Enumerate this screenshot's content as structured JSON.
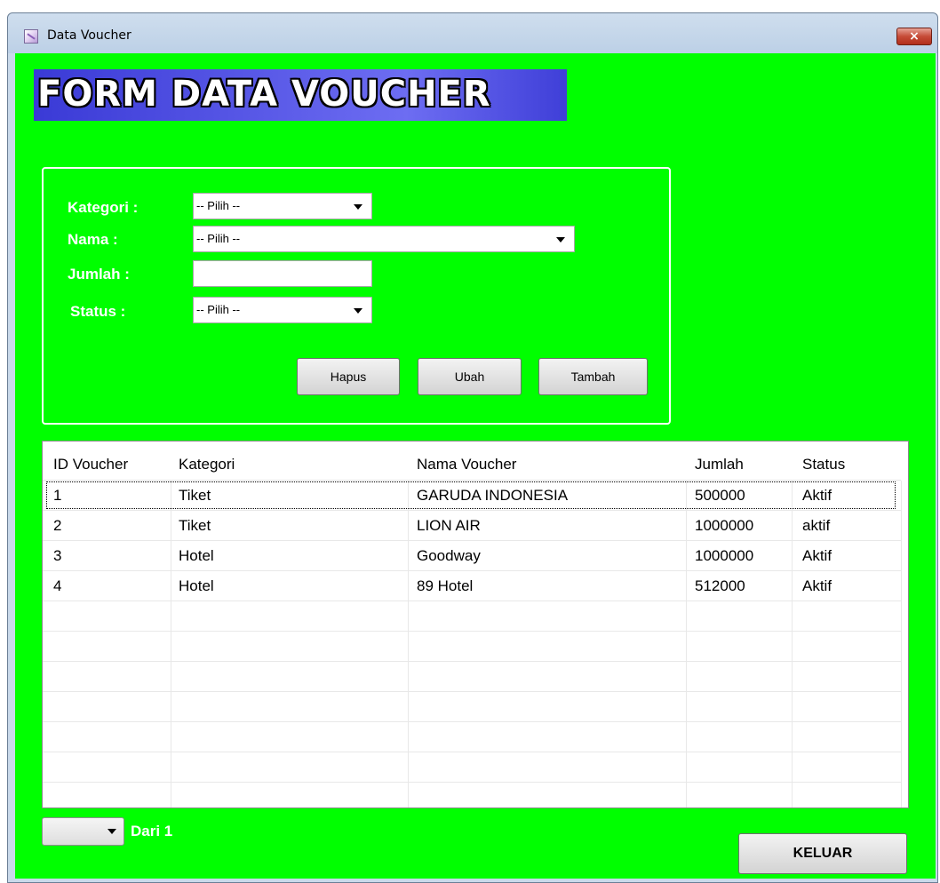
{
  "window": {
    "title": "Data Voucher",
    "close_label": "×"
  },
  "banner": {
    "text": "FORM DATA VOUCHER"
  },
  "form": {
    "kategori": {
      "label": "Kategori :",
      "value": "-- Pilih --"
    },
    "nama": {
      "label": "Nama :",
      "value": "-- Pilih --"
    },
    "jumlah": {
      "label": "Jumlah :",
      "value": ""
    },
    "status": {
      "label": "Status :",
      "value": "-- Pilih --"
    },
    "buttons": {
      "hapus": "Hapus",
      "ubah": "Ubah",
      "tambah": "Tambah"
    }
  },
  "table": {
    "columns": [
      "ID Voucher",
      "Kategori",
      "Nama Voucher",
      "Jumlah",
      "Status"
    ],
    "rows": [
      [
        "1",
        "Tiket",
        "GARUDA INDONESIA",
        "500000",
        "Aktif"
      ],
      [
        "2",
        "Tiket",
        "LION AIR",
        "1000000",
        "aktif"
      ],
      [
        "3",
        "Hotel",
        "Goodway",
        "1000000",
        "Aktif"
      ],
      [
        "4",
        "Hotel",
        "89 Hotel",
        "512000",
        "Aktif"
      ]
    ]
  },
  "pager": {
    "selected": "",
    "label": "Dari 1"
  },
  "footer": {
    "exit_label": "KELUAR"
  },
  "colors": {
    "background": "#00ff00",
    "banner": "#5050e6"
  }
}
